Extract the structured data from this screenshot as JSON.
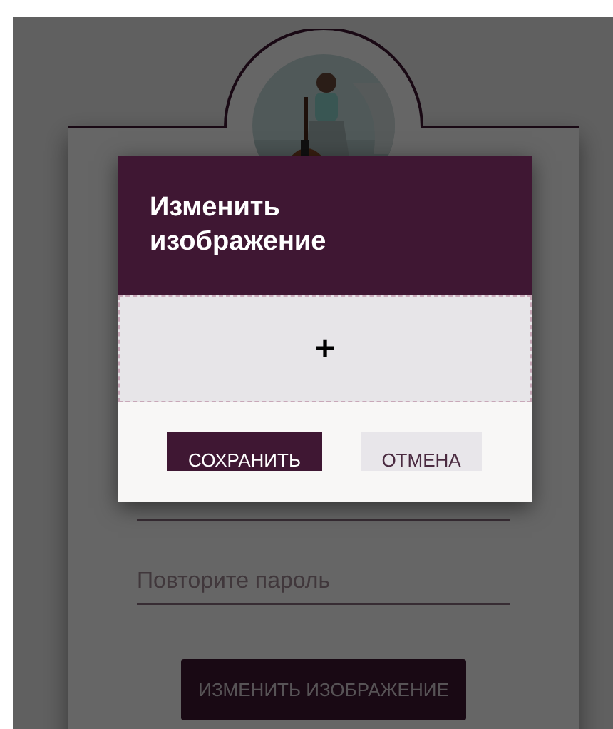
{
  "form": {
    "password_repeat": {
      "placeholder": "Повторите пароль"
    },
    "change_image_button": "ИЗМЕНИТЬ ИЗОБРАЖЕНИЕ"
  },
  "dialog": {
    "title": "Изменить изображение",
    "drop_zone": {
      "icon": "+"
    },
    "buttons": [
      {
        "label": "СОХРАНИТЬ",
        "kind": "primary"
      },
      {
        "label": "ОТМЕНА",
        "kind": "secondary"
      }
    ]
  }
}
